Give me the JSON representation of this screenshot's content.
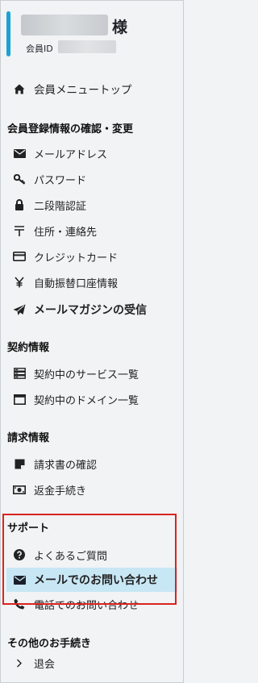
{
  "member": {
    "honorific": "様",
    "id_label": "会員ID"
  },
  "menu_top": {
    "label": "会員メニュートップ",
    "icon": "home-icon"
  },
  "sections": {
    "registration": {
      "title": "会員登録情報の確認・変更",
      "items": [
        {
          "label": "メールアドレス",
          "icon": "envelope-icon"
        },
        {
          "label": "パスワード",
          "icon": "key-icon"
        },
        {
          "label": "二段階認証",
          "icon": "lock-icon"
        },
        {
          "label": "住所・連絡先",
          "icon": "postal-mark-icon"
        },
        {
          "label": "クレジットカード",
          "icon": "credit-card-icon"
        },
        {
          "label": "自動振替口座情報",
          "icon": "yen-icon"
        },
        {
          "label": "メールマガジンの受信",
          "icon": "paper-plane-icon"
        }
      ]
    },
    "contract": {
      "title": "契約情報",
      "items": [
        {
          "label": "契約中のサービス一覧",
          "icon": "server-icon"
        },
        {
          "label": "契約中のドメイン一覧",
          "icon": "window-icon"
        }
      ]
    },
    "billing": {
      "title": "請求情報",
      "items": [
        {
          "label": "請求書の確認",
          "icon": "note-icon"
        },
        {
          "label": "返金手続き",
          "icon": "money-bill-icon"
        }
      ]
    },
    "support": {
      "title": "サポート",
      "items": [
        {
          "label": "よくあるご質問",
          "icon": "question-circle-icon"
        },
        {
          "label": "メールでのお問い合わせ",
          "icon": "envelope-icon"
        },
        {
          "label": "電話でのお問い合わせ",
          "icon": "phone-icon"
        }
      ]
    },
    "other": {
      "title": "その他のお手続き",
      "items": [
        {
          "label": "退会",
          "icon": "chevron-right-icon"
        }
      ]
    }
  },
  "colors": {
    "accent_bar": "#19a3d4",
    "active_bg": "#c8e7f5",
    "highlight_border": "#d9231d",
    "background": "#f1f3f5"
  }
}
